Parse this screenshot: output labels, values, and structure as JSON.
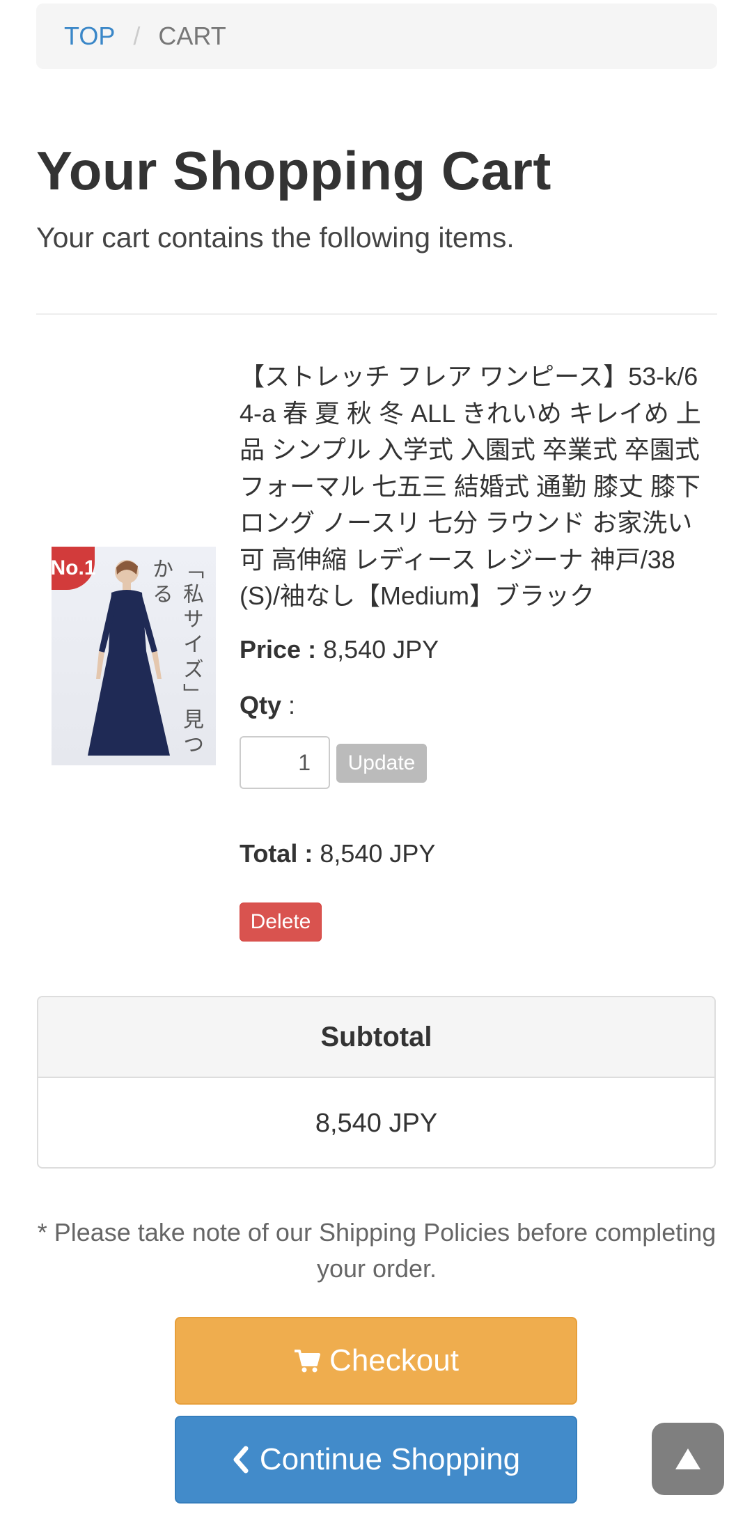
{
  "breadcrumb": {
    "home": "TOP",
    "separator": "/",
    "current": "CART"
  },
  "page": {
    "title": "Your Shopping Cart",
    "lead": "Your cart contains the following items."
  },
  "item": {
    "image_badge": "No.1",
    "image_caption": "「私サイズ」見つかる",
    "name": "【ストレッチ フレア ワンピース】53-k/64-a 春 夏 秋 冬 ALL きれいめ キレイめ 上品 シンプル 入学式 入園式 卒業式 卒園式 フォーマル 七五三 結婚式 通勤 膝丈 膝下 ロング ノースリ 七分 ラウンド お家洗い可 高伸縮 レディース レジーナ 神戸/38(S)/袖なし【Medium】ブラック",
    "price_label": "Price :",
    "price_value": "8,540 JPY",
    "qty_label": "Qty",
    "qty_colon": ":",
    "qty_value": "1",
    "update_label": "Update",
    "total_label": "Total :",
    "total_value": "8,540 JPY",
    "delete_label": "Delete"
  },
  "subtotal": {
    "heading": "Subtotal",
    "value": "8,540 JPY"
  },
  "note": "* Please take note of our Shipping Policies before completing your order.",
  "actions": {
    "checkout_label": "Checkout",
    "continue_label": "Continue Shopping"
  },
  "icons": {
    "cart": "cart-icon",
    "back": "chevron-left-icon",
    "scroll_top": "arrow-up-icon"
  },
  "colors": {
    "link": "#3a87c8",
    "checkout": "#efad4e",
    "continue": "#428bca",
    "delete": "#d9534f",
    "update": "#bbbbbb",
    "scroll_top": "#7f7f7f"
  }
}
